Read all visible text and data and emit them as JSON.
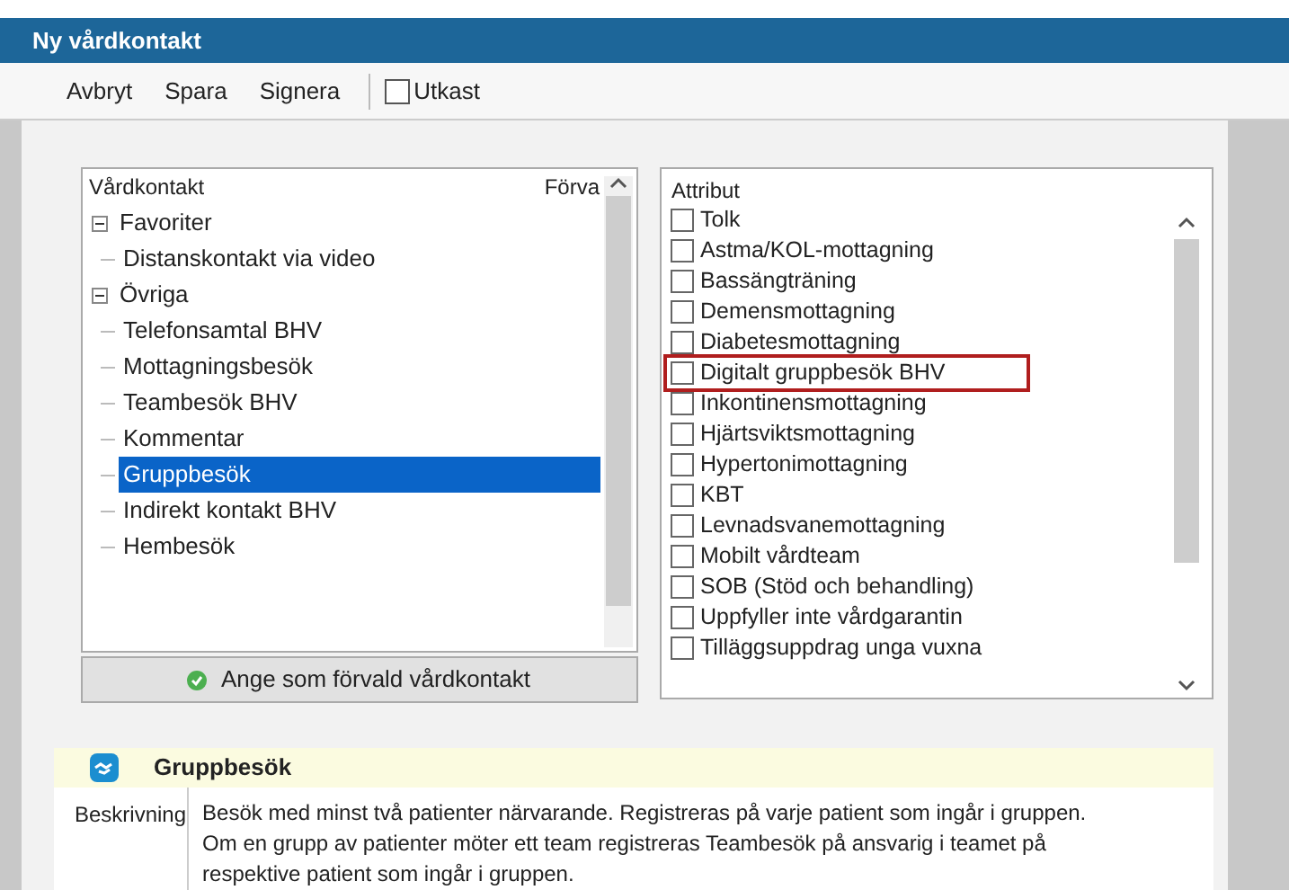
{
  "window": {
    "title": "Ny vårdkontakt"
  },
  "toolbar": {
    "buttons": [
      "Avbryt",
      "Spara",
      "Signera"
    ],
    "draft": {
      "label": "Utkast",
      "checked": false
    }
  },
  "contact_tree": {
    "columns": [
      "Vårdkontakt",
      "Förva"
    ],
    "items": [
      {
        "label": "Favoriter",
        "expanded": true,
        "selected": false,
        "children": [
          {
            "label": "Distanskontakt via video",
            "selected": false
          }
        ]
      },
      {
        "label": "Övriga",
        "expanded": true,
        "selected": false,
        "children": [
          {
            "label": "Telefonsamtal BHV",
            "selected": false
          },
          {
            "label": "Mottagningsbesök",
            "selected": false
          },
          {
            "label": "Teambesök BHV",
            "selected": false
          },
          {
            "label": "Kommentar",
            "selected": false
          },
          {
            "label": "Gruppbesök",
            "selected": true
          },
          {
            "label": "Indirekt kontakt BHV",
            "selected": false
          },
          {
            "label": "Hembesök",
            "selected": false
          }
        ]
      }
    ]
  },
  "default_button": "Ange som förvald vårdkontakt",
  "attributes": {
    "title": "Attribut",
    "items": [
      {
        "label": "Tolk",
        "checked": false,
        "highlighted": false
      },
      {
        "label": "Astma/KOL-mottagning",
        "checked": false,
        "highlighted": false
      },
      {
        "label": "Bassängträning",
        "checked": false,
        "highlighted": false
      },
      {
        "label": "Demensmottagning",
        "checked": false,
        "highlighted": false
      },
      {
        "label": "Diabetesmottagning",
        "checked": false,
        "highlighted": false
      },
      {
        "label": "Digitalt gruppbesök BHV",
        "checked": false,
        "highlighted": true
      },
      {
        "label": "Inkontinensmottagning",
        "checked": false,
        "highlighted": false
      },
      {
        "label": "Hjärtsviktsmottagning",
        "checked": false,
        "highlighted": false
      },
      {
        "label": "Hypertonimottagning",
        "checked": false,
        "highlighted": false
      },
      {
        "label": "KBT",
        "checked": false,
        "highlighted": false
      },
      {
        "label": "Levnadsvanemottagning",
        "checked": false,
        "highlighted": false
      },
      {
        "label": "Mobilt vårdteam",
        "checked": false,
        "highlighted": false
      },
      {
        "label": "SOB (Stöd och behandling)",
        "checked": false,
        "highlighted": false
      },
      {
        "label": "Uppfyller inte vårdgarantin",
        "checked": false,
        "highlighted": false
      },
      {
        "label": "Tilläggsuppdrag unga vuxna",
        "checked": false,
        "highlighted": false
      }
    ]
  },
  "info": {
    "title": "Gruppbesök",
    "label": "Beskrivning",
    "text": "Besök med minst två patienter närvarande. Registreras på varje patient som ingår i gruppen. Om en grupp av patienter möter ett team registreras Teambesök på ansvarig i teamet på respektive patient som ingår i gruppen."
  }
}
